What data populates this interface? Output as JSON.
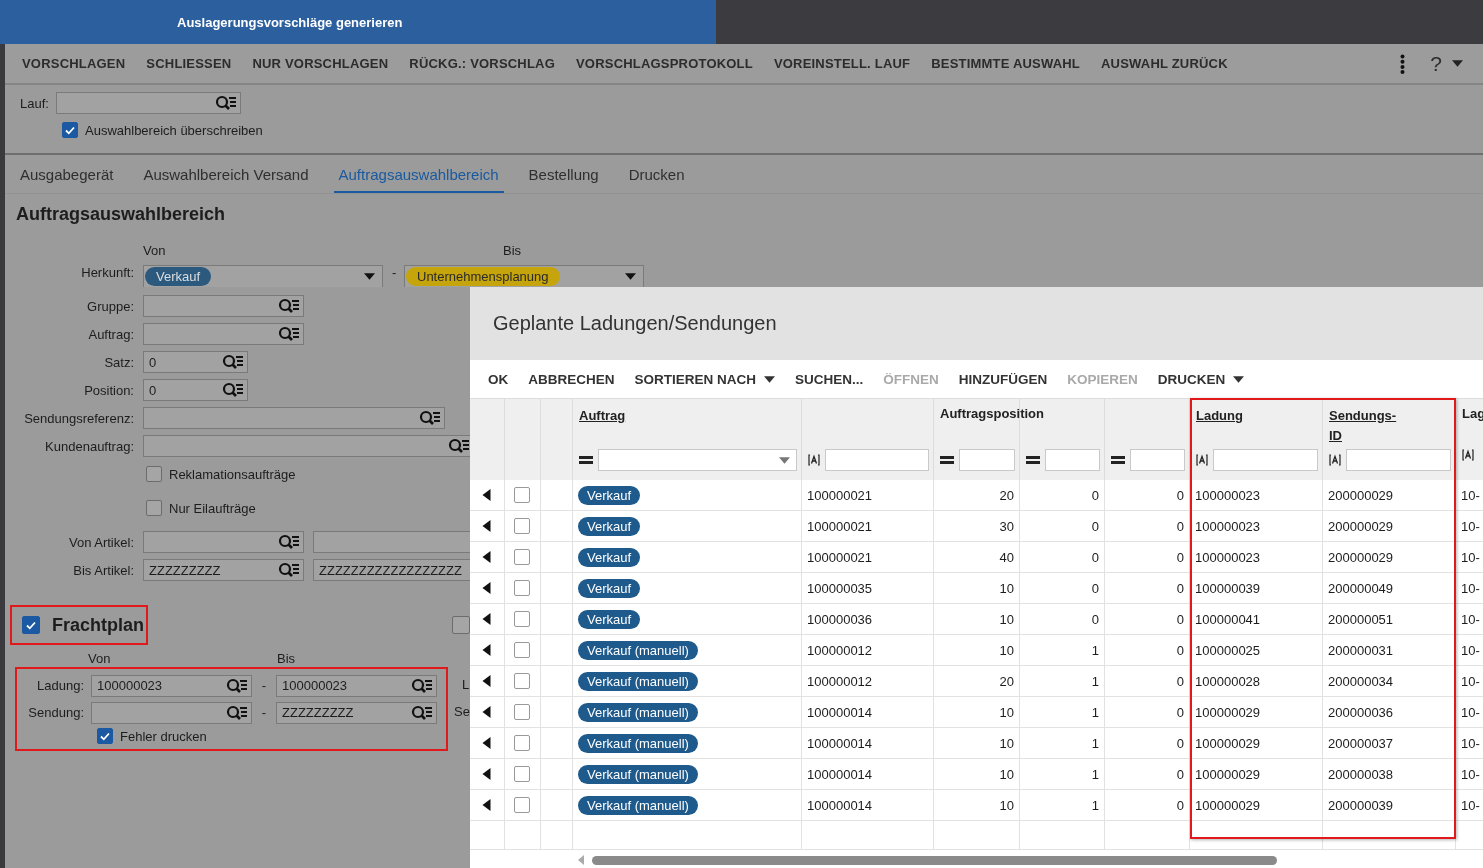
{
  "window": {
    "title": "Auslagerungsvorschläge generieren"
  },
  "toolbar": {
    "actions": [
      "VORSCHLAGEN",
      "SCHLIESSEN",
      "NUR VORSCHLAGEN",
      "RÜCKG.: VORSCHLAG",
      "VORSCHLAGSPROTOKOLL",
      "VOREINSTELL. LAUF",
      "BESTIMMTE AUSWAHL",
      "AUSWAHL ZURÜCK"
    ],
    "help": "?"
  },
  "run_field": {
    "label": "Lauf:"
  },
  "override_checkbox": {
    "label": "Auswahlbereich überschreiben",
    "checked": true
  },
  "tabs": [
    {
      "label": "Ausgabegerät",
      "selected": false
    },
    {
      "label": "Auswahlbereich Versand",
      "selected": false
    },
    {
      "label": "Auftragsauswahlbereich",
      "selected": true
    },
    {
      "label": "Bestellung",
      "selected": false
    },
    {
      "label": "Drucken",
      "selected": false
    }
  ],
  "section": {
    "title": "Auftragsauswahlbereich",
    "from_label": "Von",
    "to_label": "Bis",
    "origin": {
      "label": "Herkunft:",
      "separator": "-",
      "from": {
        "value": "Verkauf",
        "color": "#2c5a7e"
      },
      "to": {
        "value": "Unternehmensplanung",
        "color": "#c6a50c"
      }
    },
    "fields": [
      {
        "kind": "lookup",
        "label": "Gruppe:"
      },
      {
        "kind": "lookup",
        "label": "Auftrag:"
      },
      {
        "kind": "short",
        "label": "Satz:",
        "value": "0"
      },
      {
        "kind": "short",
        "label": "Position:",
        "value": "0"
      },
      {
        "kind": "long",
        "label": "Sendungsreferenz:"
      },
      {
        "kind": "wide",
        "label": "Kundenauftrag:"
      },
      {
        "kind": "checkbox",
        "label": "Reklamationsaufträge",
        "checked": false
      },
      {
        "kind": "checkbox",
        "label": "Nur Eilaufträge",
        "checked": false
      },
      {
        "kind": "range",
        "label": "Von Artikel:"
      },
      {
        "kind": "range",
        "label": "Bis Artikel:",
        "value": "ZZZZZZZZZ",
        "second_value": "ZZZZZZZZZZZZZZZZZZ"
      }
    ]
  },
  "freight_plan": {
    "label": "Frachtplan",
    "checked": true,
    "highlighted": true,
    "side_checkbox_checked": false,
    "from_label": "Von",
    "to_label": "Bis",
    "rows_highlighted": true,
    "rows": [
      {
        "label": "Ladung:",
        "from": "100000023",
        "separator": "-",
        "to": "100000023",
        "next_label": "L"
      },
      {
        "label": "Sendung:",
        "separator": "-",
        "to": "ZZZZZZZZZ",
        "next_label": "Se"
      }
    ],
    "print_errors": {
      "label": "Fehler drucken",
      "checked": true
    }
  },
  "dialog": {
    "title": "Geplante Ladungen/Sendungen",
    "actions": [
      {
        "label": "OK",
        "disabled": false,
        "menu": false
      },
      {
        "label": "ABBRECHEN",
        "disabled": false,
        "menu": false
      },
      {
        "label": "SORTIEREN NACH",
        "disabled": false,
        "menu": true
      },
      {
        "label": "SUCHEN...",
        "disabled": false,
        "menu": false
      },
      {
        "label": "ÖFFNEN",
        "disabled": true,
        "menu": false
      },
      {
        "label": "HINZUFÜGEN",
        "disabled": false,
        "menu": false
      },
      {
        "label": "KOPIEREN",
        "disabled": true,
        "menu": false
      },
      {
        "label": "DRUCKEN",
        "disabled": false,
        "menu": true
      }
    ],
    "columns": [
      {
        "label": "Auftrag",
        "link": true,
        "kind": "select"
      },
      {
        "kind": "text"
      },
      {
        "label": "Auftragsposition",
        "link": false,
        "kind": "equals"
      },
      {
        "kind": "equals"
      },
      {
        "kind": "equals"
      },
      {
        "label": "Ladung",
        "link": true,
        "kind": "text"
      },
      {
        "label": "Sendungs-ID",
        "link": true,
        "kind": "text"
      },
      {
        "label": "Lag",
        "link": false,
        "kind": "marker"
      }
    ],
    "columns_highlighted": true,
    "rows": [
      {
        "checked": false,
        "cells": [
          "Verkauf",
          "100000021",
          "20",
          "0",
          "0",
          "100000023",
          "200000029",
          "10-"
        ]
      },
      {
        "checked": false,
        "cells": [
          "Verkauf",
          "100000021",
          "30",
          "0",
          "0",
          "100000023",
          "200000029",
          "10-"
        ]
      },
      {
        "checked": false,
        "cells": [
          "Verkauf",
          "100000021",
          "40",
          "0",
          "0",
          "100000023",
          "200000029",
          "10-"
        ]
      },
      {
        "checked": false,
        "cells": [
          "Verkauf",
          "100000035",
          "10",
          "0",
          "0",
          "100000039",
          "200000049",
          "10-"
        ]
      },
      {
        "checked": false,
        "cells": [
          "Verkauf",
          "100000036",
          "10",
          "0",
          "0",
          "100000041",
          "200000051",
          "10-"
        ]
      },
      {
        "checked": false,
        "cells": [
          "Verkauf (manuell)",
          "100000012",
          "10",
          "1",
          "0",
          "100000025",
          "200000031",
          "10-"
        ]
      },
      {
        "checked": false,
        "cells": [
          "Verkauf (manuell)",
          "100000012",
          "20",
          "1",
          "0",
          "100000028",
          "200000034",
          "10-"
        ]
      },
      {
        "checked": false,
        "cells": [
          "Verkauf (manuell)",
          "100000014",
          "10",
          "1",
          "0",
          "100000029",
          "200000036",
          "10-"
        ]
      },
      {
        "checked": false,
        "cells": [
          "Verkauf (manuell)",
          "100000014",
          "10",
          "1",
          "0",
          "100000029",
          "200000037",
          "10-"
        ]
      },
      {
        "checked": false,
        "cells": [
          "Verkauf (manuell)",
          "100000014",
          "10",
          "1",
          "0",
          "100000029",
          "200000038",
          "10-"
        ]
      },
      {
        "checked": false,
        "cells": [
          "Verkauf (manuell)",
          "100000014",
          "10",
          "1",
          "0",
          "100000029",
          "200000039",
          "10-"
        ]
      }
    ]
  }
}
